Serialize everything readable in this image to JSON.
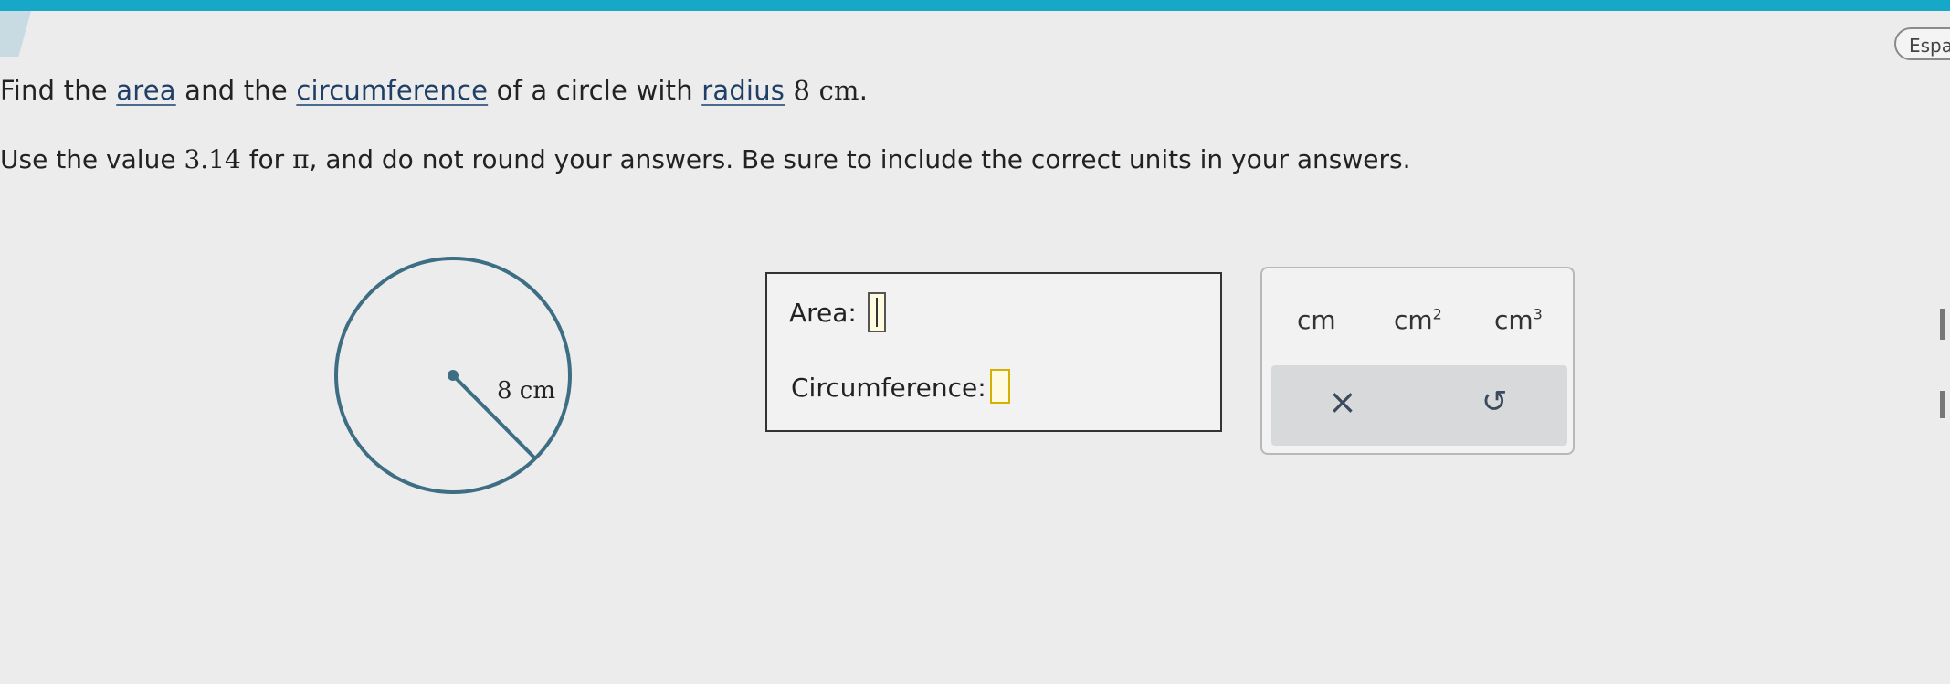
{
  "header": {
    "language_button": "Espa"
  },
  "question": {
    "line1": {
      "p1": "Find the ",
      "area_link": "area",
      "p2": " and the ",
      "circumference_link": "circumference",
      "p3": " of a circle with ",
      "radius_link": "radius",
      "p4": " ",
      "radius_value": "8 cm",
      "p5": "."
    },
    "line2": {
      "p1": "Use the value ",
      "pi_value": "3.14",
      "p2": " for ",
      "pi_symbol": "π",
      "p3": ", and do not round your answers. Be sure to include the correct units in your answers."
    }
  },
  "figure": {
    "radius_label": "8 cm"
  },
  "answers": {
    "area_label": "Area:",
    "area_value": "",
    "circumference_label": "Circumference:",
    "circumference_value": ""
  },
  "keypad": {
    "units": [
      "cm",
      "cm",
      "cm"
    ],
    "unit_exponents": [
      "",
      "2",
      "3"
    ],
    "clear_symbol": "×",
    "undo_symbol": "↺"
  },
  "colors": {
    "accent_bar": "#17a7c7",
    "circle_stroke": "#3d6e83",
    "link": "#1f3f66",
    "focus_slot": "#d4b100"
  }
}
